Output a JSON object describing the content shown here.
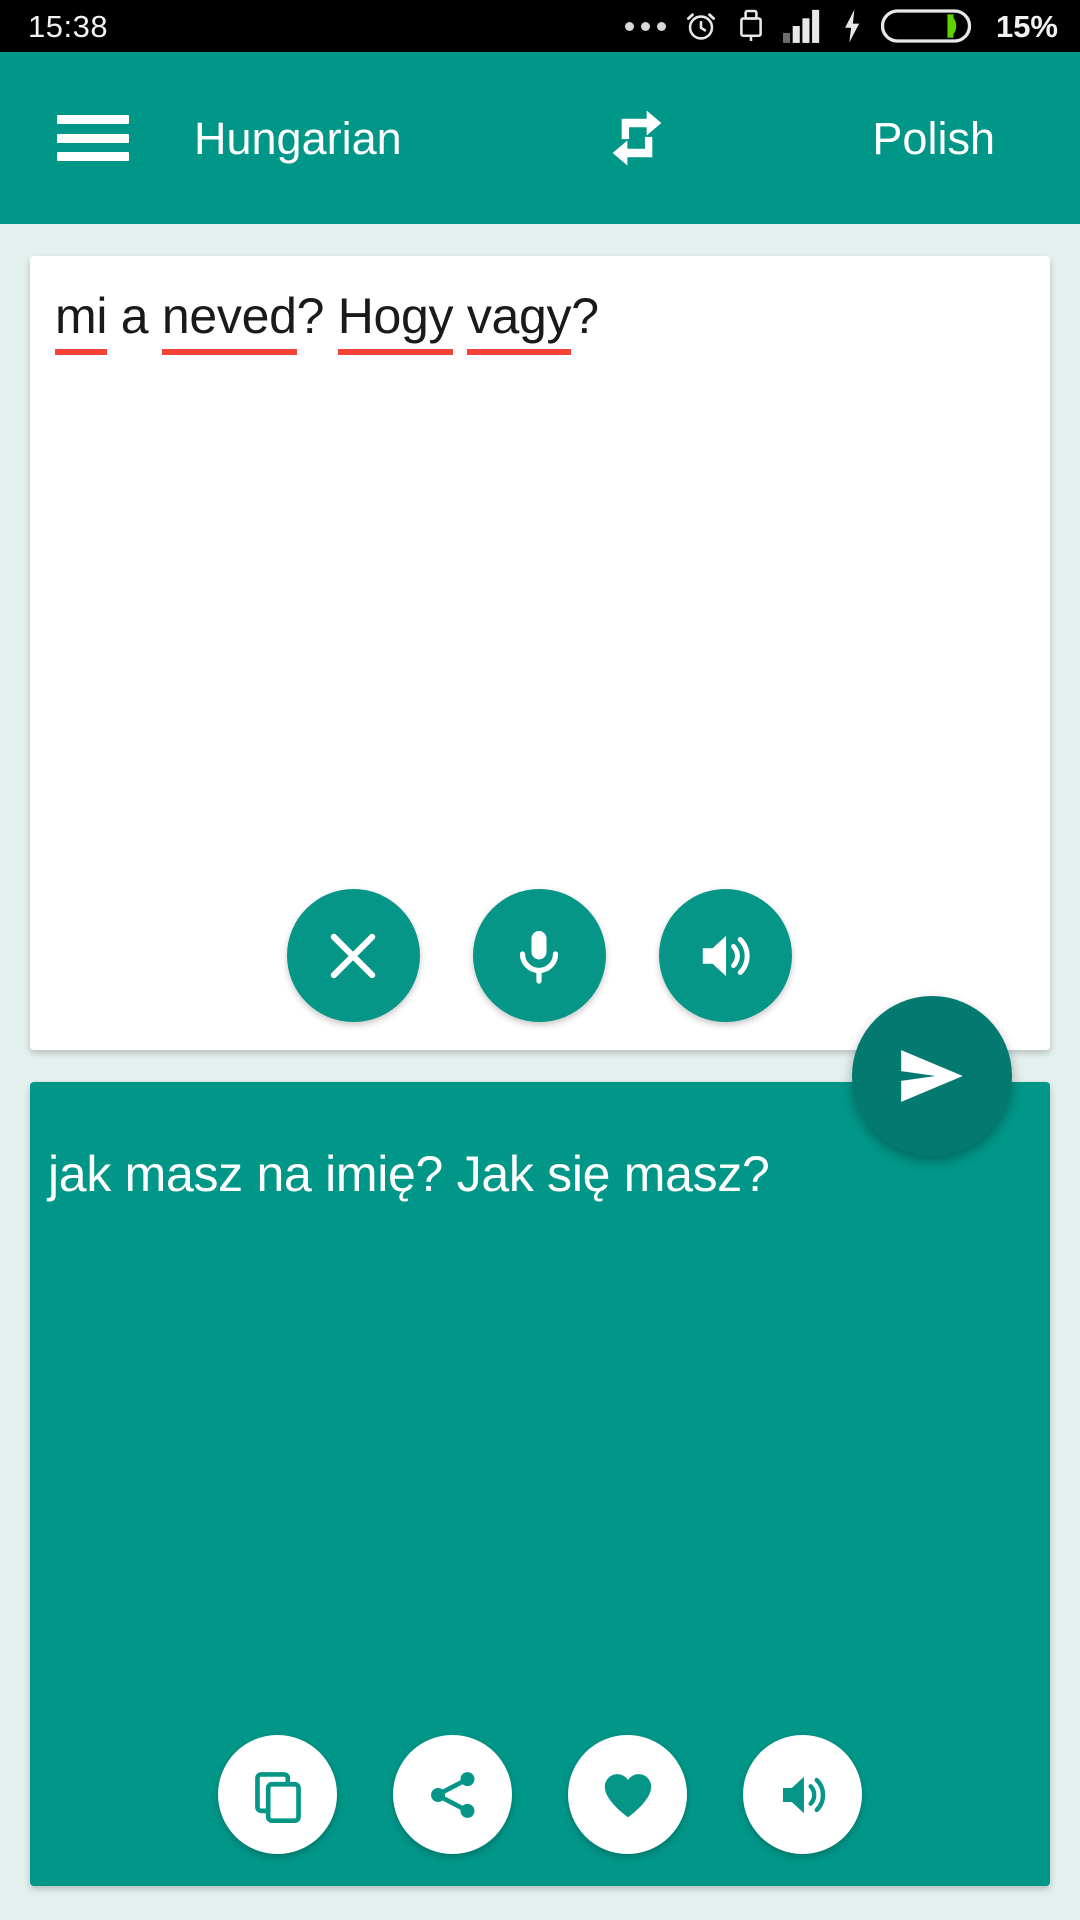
{
  "status_bar": {
    "clock": "15:38",
    "battery_percent": "15%",
    "icons": [
      "more-dots-icon",
      "alarm-clock-icon",
      "usb-lock-icon",
      "signal-bars-icon",
      "charging-bolt-icon",
      "battery-icon"
    ],
    "battery_level": 15,
    "battery_fill_color": "#5fd200",
    "background_color": "#000000",
    "text_color": "#f2f2f2"
  },
  "app_bar": {
    "menu_icon": "hamburger-menu-icon",
    "source_language": "Hungarian",
    "swap_icon": "swap-languages-icon",
    "target_language": "Polish",
    "background_color": "#009688",
    "text_color": "#ffffff"
  },
  "source_card": {
    "text": "mi a neved? Hogy vagy?",
    "spellcheck_words": [
      "mi",
      "neved",
      "Hogy",
      "vagy"
    ],
    "spellcheck_color": "#f4433a",
    "background_color": "#ffffff",
    "text_color": "#1a1a1a",
    "actions": [
      {
        "name": "clear-button",
        "icon": "close-icon",
        "label": "Clear"
      },
      {
        "name": "voice-input-button",
        "icon": "microphone-icon",
        "label": "Voice input"
      },
      {
        "name": "speak-source-button",
        "icon": "speaker-icon",
        "label": "Listen"
      }
    ]
  },
  "send_button": {
    "name": "translate-send-button",
    "icon": "send-icon",
    "label": "Translate",
    "background_color": "#03796f"
  },
  "target_card": {
    "text": "jak masz na imię? Jak się masz?",
    "background_color": "#009688",
    "text_color": "#ffffff",
    "actions": [
      {
        "name": "copy-button",
        "icon": "copy-icon",
        "label": "Copy"
      },
      {
        "name": "share-button",
        "icon": "share-icon",
        "label": "Share"
      },
      {
        "name": "favorite-button",
        "icon": "heart-icon",
        "label": "Favorite"
      },
      {
        "name": "speak-target-button",
        "icon": "speaker-icon",
        "label": "Listen"
      }
    ]
  },
  "page": {
    "background_color": "#e3f0ee"
  }
}
